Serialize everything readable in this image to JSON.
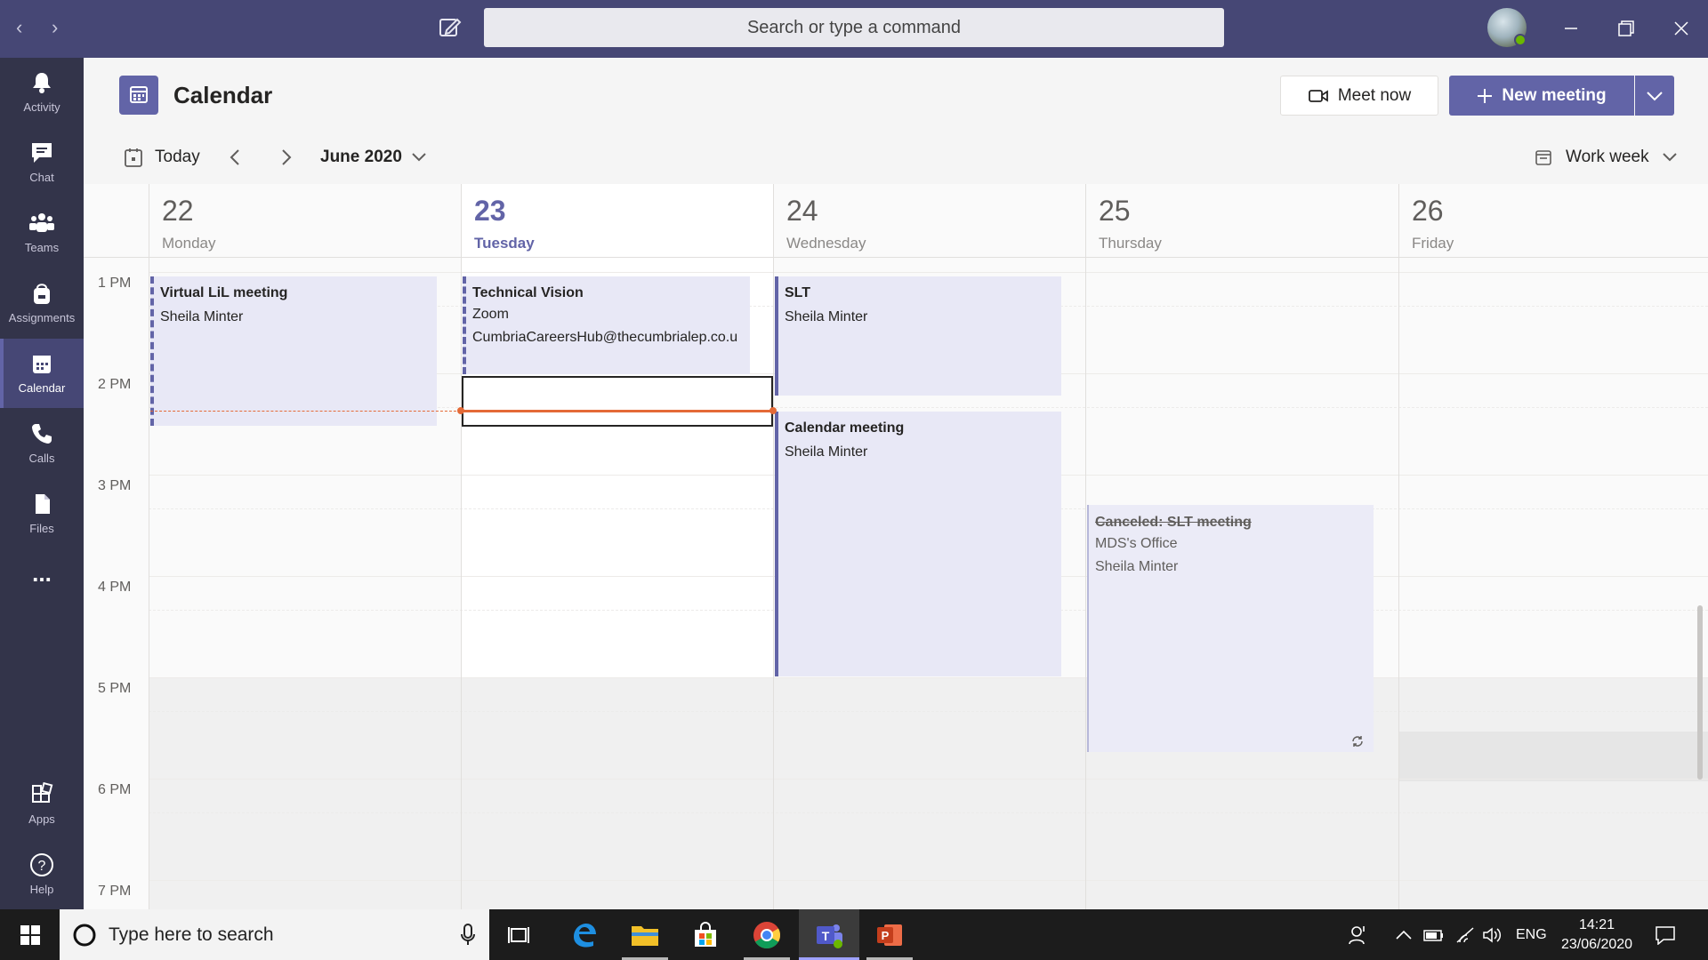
{
  "search": {
    "placeholder": "Search or type a command"
  },
  "rail": [
    {
      "key": "activity",
      "label": "Activity"
    },
    {
      "key": "chat",
      "label": "Chat"
    },
    {
      "key": "teams",
      "label": "Teams"
    },
    {
      "key": "assignments",
      "label": "Assignments"
    },
    {
      "key": "calendar",
      "label": "Calendar",
      "active": true
    },
    {
      "key": "calls",
      "label": "Calls"
    },
    {
      "key": "files",
      "label": "Files"
    },
    {
      "key": "more",
      "label": "..."
    },
    {
      "key": "apps",
      "label": "Apps"
    },
    {
      "key": "help",
      "label": "Help"
    }
  ],
  "header": {
    "title": "Calendar",
    "meet_now": "Meet now",
    "new_meeting": "New meeting"
  },
  "toolbar": {
    "today": "Today",
    "month": "June 2020",
    "view": "Work week"
  },
  "days": [
    {
      "num": "22",
      "name": "Monday"
    },
    {
      "num": "23",
      "name": "Tuesday",
      "today": true
    },
    {
      "num": "24",
      "name": "Wednesday"
    },
    {
      "num": "25",
      "name": "Thursday"
    },
    {
      "num": "26",
      "name": "Friday"
    }
  ],
  "times": [
    "1 PM",
    "2 PM",
    "3 PM",
    "4 PM",
    "5 PM",
    "6 PM",
    "7 PM"
  ],
  "events": [
    {
      "title": "Virtual LiL meeting",
      "lines": [
        "Sheila Minter"
      ]
    },
    {
      "title": "Technical Vision",
      "lines": [
        "Zoom",
        "CumbriaCareersHub@thecumbrialep.co.u"
      ]
    },
    {
      "title": "SLT",
      "lines": [
        "Sheila Minter"
      ]
    },
    {
      "title": "Calendar meeting",
      "lines": [
        "Sheila Minter"
      ]
    },
    {
      "title": "Canceled: SLT meeting",
      "lines": [
        "MDS's Office",
        "Sheila Minter"
      ]
    }
  ],
  "taskbar": {
    "search_placeholder": "Type here to search",
    "lang": "ENG",
    "time": "14:21",
    "date": "23/06/2020"
  },
  "colors": {
    "brand": "#6264a7",
    "titlebar": "#464775",
    "rail": "#33344a",
    "now_line": "#e46a37"
  }
}
